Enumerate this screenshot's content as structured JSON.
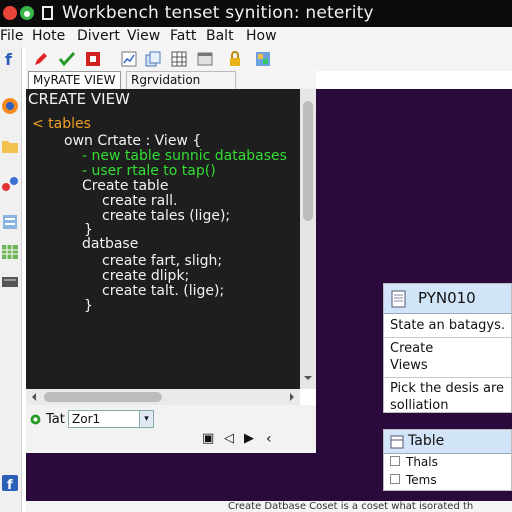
{
  "window": {
    "title": "Workbench tenset synition: neterity"
  },
  "menu": {
    "items": [
      "File",
      "Hote",
      "Divert",
      "View",
      "Fatt",
      "Balt",
      "How"
    ]
  },
  "toolbar": {
    "icons": [
      "pencil-icon",
      "check-icon",
      "stop-icon",
      "chart-icon",
      "copy-icon",
      "grid-icon",
      "table-icon",
      "lock-icon",
      "image-icon"
    ]
  },
  "tabs": [
    {
      "label": "MyRATE VIEW",
      "active": true
    },
    {
      "label": "Rgrvidation",
      "active": false
    }
  ],
  "editor": {
    "lines": [
      {
        "text": "CREATE VIEW",
        "color": "#ffffff"
      },
      {
        "text": "< tables",
        "color": "#f0a020"
      },
      {
        "text": "own Crtate : View {",
        "color": "#f3f3f3"
      },
      {
        "text": "- new table sunnic databases",
        "color": "#33dd33"
      },
      {
        "text": "- user rtale to tap()",
        "color": "#33dd33"
      },
      {
        "text": "Create table",
        "color": "#f3f3f3"
      },
      {
        "text": "create rall.",
        "color": "#f3f3f3"
      },
      {
        "text": "create tales (lige);",
        "color": "#f3f3f3"
      },
      {
        "text": "}",
        "color": "#f3f3f3"
      },
      {
        "text": "datbase",
        "color": "#f3f3f3"
      },
      {
        "text": "create fart, sligh;",
        "color": "#f3f3f3"
      },
      {
        "text": "create dlipk;",
        "color": "#f3f3f3"
      },
      {
        "text": "create talt. (lige);",
        "color": "#f3f3f3"
      },
      {
        "text": "}",
        "color": "#f3f3f3"
      }
    ]
  },
  "bottom": {
    "label": "Tat",
    "select_value": "Zor1",
    "controls": [
      "▣",
      "◁",
      "▶",
      "‹"
    ]
  },
  "cards": {
    "top": {
      "header": "PYN010",
      "rows": [
        "State an batagys.",
        "Create",
        "Views",
        "Pick the desis are",
        "solliation"
      ]
    },
    "bottom": {
      "header": "Table",
      "rows": [
        "Thals",
        "Tems"
      ]
    }
  },
  "status": {
    "text": "Create Datbase Coset is a coset what isorated th"
  },
  "colors": {
    "canvas": "#2a0a3c",
    "editor_bg": "#1e1e1e",
    "card_header": "#d2e4f7"
  }
}
